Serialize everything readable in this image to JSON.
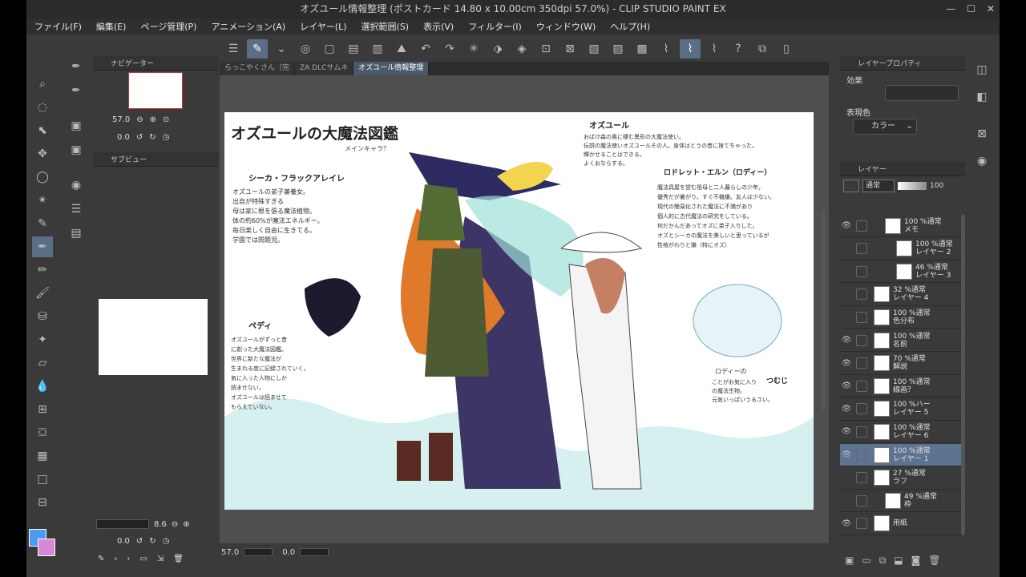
{
  "window": {
    "title": "オズユール情報整理 (ポストカード 14.80 x 10.00cm 350dpi 57.0%) - CLIP STUDIO PAINT EX"
  },
  "menu": [
    "ファイル(F)",
    "編集(E)",
    "ページ管理(P)",
    "アニメーション(A)",
    "レイヤー(L)",
    "選択範囲(S)",
    "表示(V)",
    "フィルター(I)",
    "ウィンドウ(W)",
    "ヘルプ(H)"
  ],
  "tabs": [
    {
      "label": "らっこやくさん（完"
    },
    {
      "label": "ZA DLCサムネ"
    },
    {
      "label": "オズユール情報整理"
    }
  ],
  "navigator": {
    "title": "ナビゲーター",
    "zoom": "57.0",
    "rotate": "0.0"
  },
  "subview": {
    "title": "サブビュー"
  },
  "brush": {
    "size": "8.6",
    "rotate": "0.0"
  },
  "status": {
    "zoom": "57.0",
    "rotate": "0.0"
  },
  "layer_property": {
    "title": "レイヤープロパティ",
    "effect_label": "効果",
    "color_label": "表現色",
    "color_value": "カラー"
  },
  "layers_panel": {
    "title": "レイヤー",
    "blend": "通常",
    "opacity": "100"
  },
  "layers": [
    {
      "pct": "100 %通常",
      "name": "メモ"
    },
    {
      "pct": "100 %通常",
      "name": "レイヤー 2"
    },
    {
      "pct": "46 %通常",
      "name": "レイヤー 3"
    },
    {
      "pct": "32 %通常",
      "name": "レイヤー 4"
    },
    {
      "pct": "100 %通常",
      "name": "色分布"
    },
    {
      "pct": "100 %通常",
      "name": "名前"
    },
    {
      "pct": "70 %通常",
      "name": "解説"
    },
    {
      "pct": "100 %通常",
      "name": "線画？"
    },
    {
      "pct": "100 %ハー",
      "name": "レイヤー 5"
    },
    {
      "pct": "100 %通常",
      "name": "レイヤー 6"
    },
    {
      "pct": "100 %通常",
      "name": "レイヤー 1"
    },
    {
      "pct": "27 %通常",
      "name": "ラフ"
    },
    {
      "pct": "49 %通常",
      "name": "枠"
    },
    {
      "pct": "",
      "name": "用紙"
    }
  ],
  "art": {
    "title": "オズユールの大魔法図鑑",
    "subtitle": "メインキャラ？",
    "n1": "シーカ・フラックアレイレ",
    "t1": [
      "オズユールの弟子兼養女。",
      "出自が特殊すぎる",
      "母は家に根を張る魔法植物。",
      "体の約60%が魔法エネルギー。",
      "毎日楽しく自由に生きてる。",
      "学園では問題児。"
    ],
    "n2": "オズユール",
    "t2": [
      "おばけ森の奥に棲む異形の大魔法使い。",
      "伝説の魔法使いオズユールその人。身体はとうの昔に捨てちゃった。",
      "輝かせることはできる。",
      "よくおならする。"
    ],
    "n3": "ロドレット・エルン（ロディー）",
    "t3": [
      "魔法具屋を営む祖母と二人暮らしの少年。",
      "優秀だが暑がり。すぐ不機嫌。友人は少ない。",
      "現代の簡易化された魔法に不満があり",
      "個人的に古代魔法の研究をしている。",
      "何だかんだあってオズに弟子入りした。",
      "オズとシーカの魔法を美しいと思っているが",
      "性格がわりと嫌（特にオズ）"
    ],
    "n4": "ペディ",
    "t4": [
      "オズユールがずっと昔",
      "に創った大魔法図鑑。",
      "世界に新たな魔法が",
      "生まれる度に記録されていく。",
      "気に入った人物にしか",
      "読ませない。",
      "オズユールは読ませて",
      "もらえていない。"
    ],
    "n5": "ロディーの",
    "t5": [
      "ことがお気に入り",
      "の魔法生物。",
      "元気いっぱいうるさい。"
    ],
    "n6": "つむじ"
  },
  "colors": {
    "accent": "#5b9bd5",
    "selected": "#5d7391",
    "fg": "#4a9cf0",
    "bg": "#d58ad8"
  }
}
